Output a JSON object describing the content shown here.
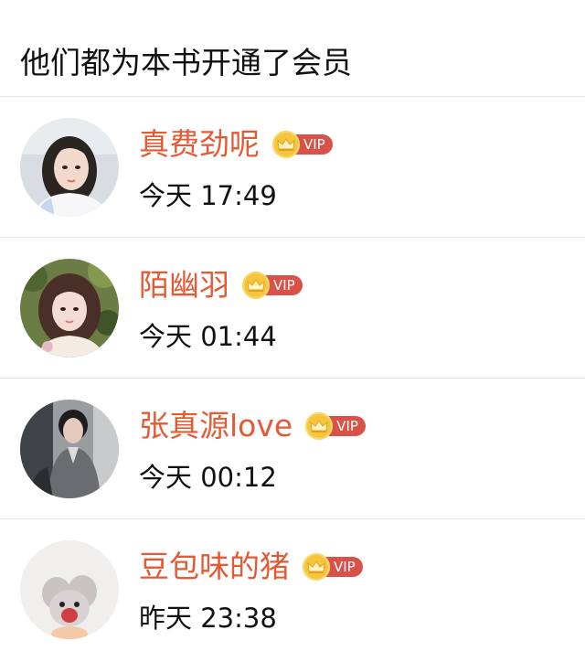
{
  "header": {
    "title": "他们都为本书开通了会员"
  },
  "vip_badge_text": "VIP",
  "colors": {
    "name": "#e35a34",
    "vip_badge": "#d8524a",
    "crown": "#f6c53c",
    "divider": "#e6e6e6"
  },
  "members": [
    {
      "name": "真费劲呢",
      "time": "今天 17:49",
      "avatar": "avatar-girl-white-shirt"
    },
    {
      "name": "陌幽羽",
      "time": "今天 01:44",
      "avatar": "avatar-girl-flowers"
    },
    {
      "name": "张真源love",
      "time": "今天 00:12",
      "avatar": "avatar-young-man"
    },
    {
      "name": "豆包味的猪",
      "time": "昨天 23:38",
      "avatar": "avatar-cartoon-mouse"
    }
  ]
}
